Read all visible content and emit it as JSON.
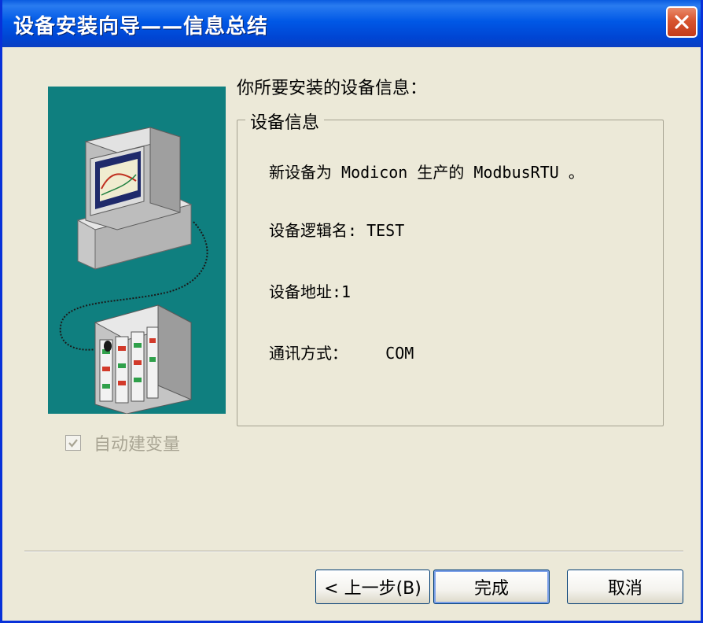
{
  "window": {
    "title": "设备安装向导——信息总结",
    "close_icon": "close-icon"
  },
  "wizard": {
    "heading": "你所要安装的设备信息：",
    "group_title": "设备信息",
    "lines": [
      "新设备为 Modicon 生产的 ModbusRTU 。",
      "设备逻辑名: TEST",
      "设备地址:1",
      "通讯方式：    COM"
    ],
    "autocreate": {
      "label": "自动建变量",
      "checked": true,
      "enabled": false
    }
  },
  "buttons": {
    "back": "< 上一步(B)",
    "finish": "完成",
    "cancel": "取消"
  },
  "colors": {
    "titlebar": "#0058e6",
    "dialog_bg": "#ece9d8",
    "illustration_bg": "#0f7f7f",
    "close_button": "#d8552f"
  }
}
